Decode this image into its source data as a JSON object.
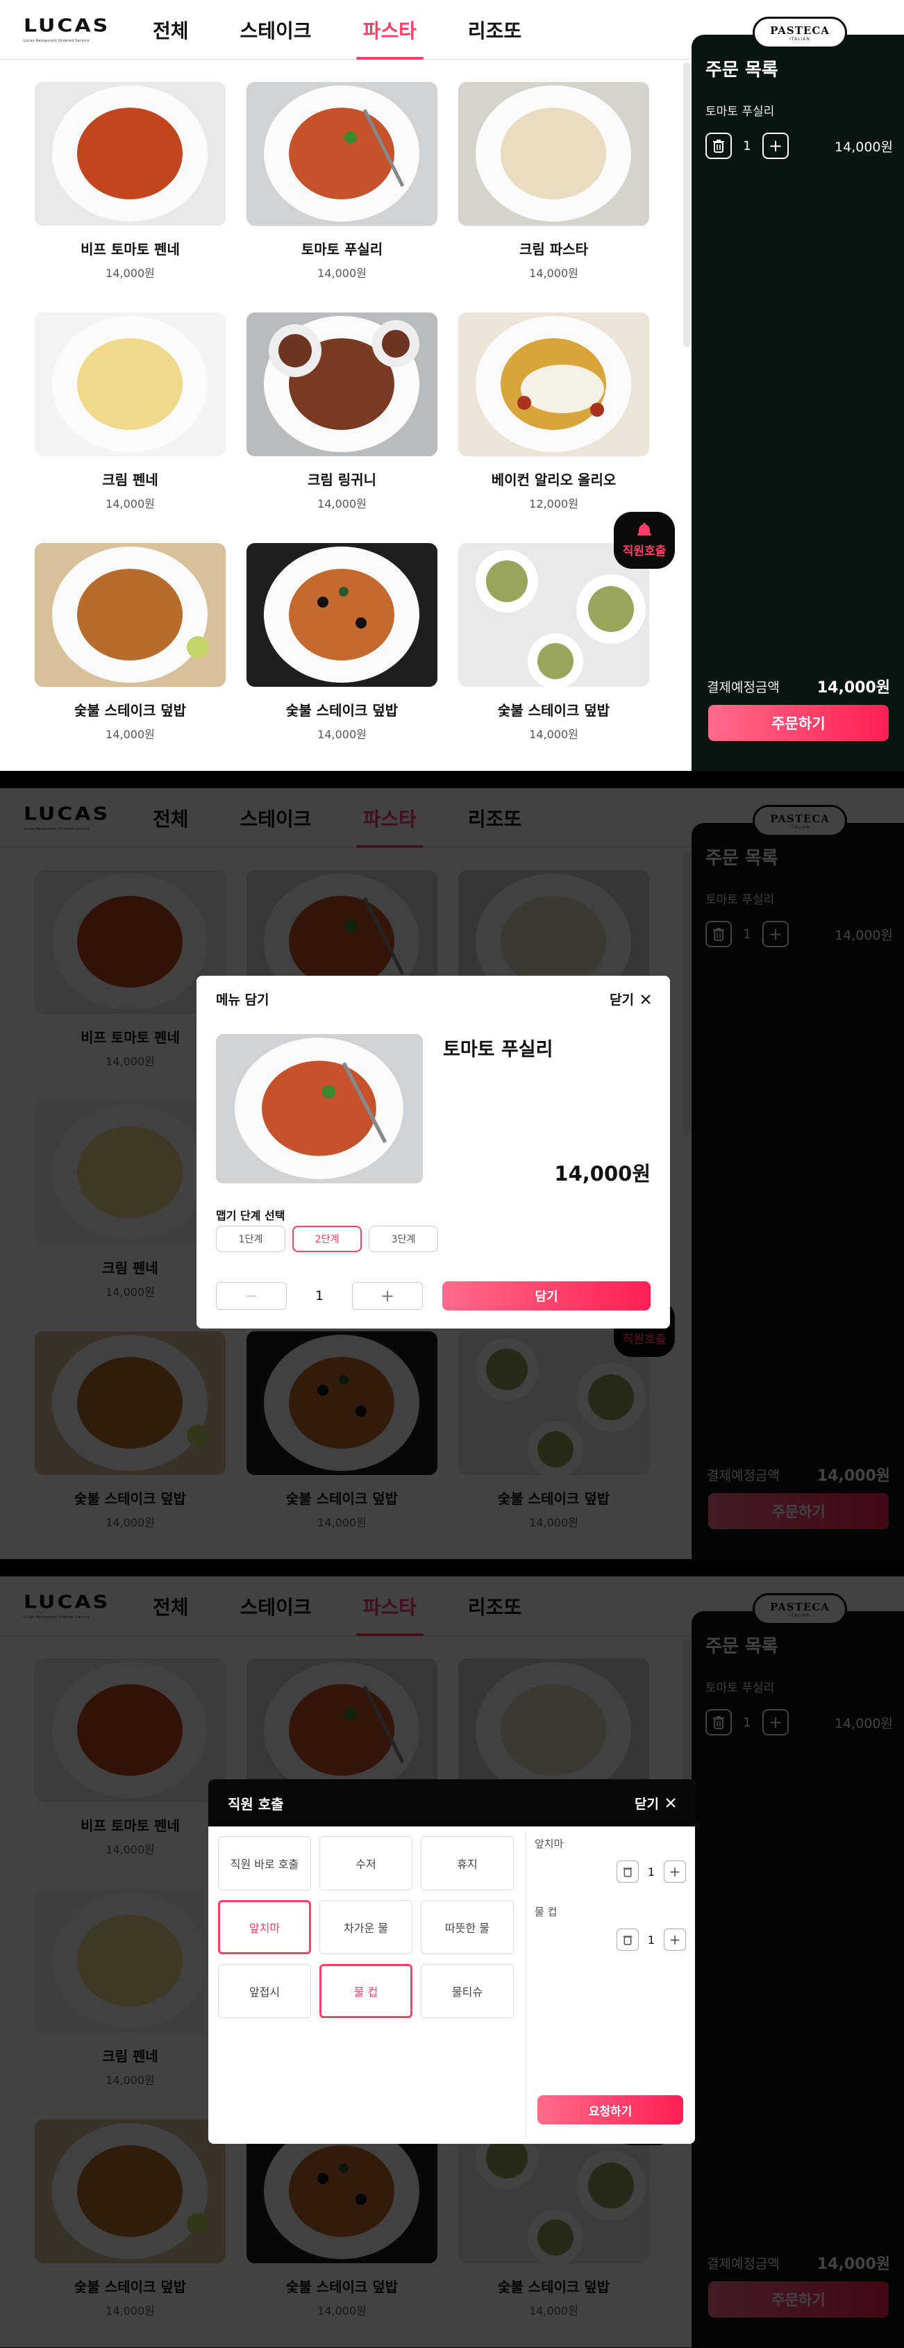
{
  "brand": {
    "logo": "LUCAS",
    "logo_sub": "Lucas Restaurant Ordered Service",
    "badge": "PASTECA",
    "badge_sub": "ITALIAN"
  },
  "nav": [
    "전체",
    "스테이크",
    "파스타",
    "리조또"
  ],
  "nav_active": "파스타",
  "menu": [
    {
      "name": "비프 토마토 펜네",
      "price": "14,000원"
    },
    {
      "name": "토마토 푸실리",
      "price": "14,000원"
    },
    {
      "name": "크림 파스타",
      "price": "14,000원"
    },
    {
      "name": "크림 펜네",
      "price": "14,000원"
    },
    {
      "name": "크림 링귀니",
      "price": "14,000원"
    },
    {
      "name": "베이컨 알리오 올리오",
      "price": "12,000원"
    },
    {
      "name": "숯불 스테이크 덮밥",
      "price": "14,000원"
    },
    {
      "name": "숯불 스테이크 덮밥",
      "price": "14,000원"
    },
    {
      "name": "숯불 스테이크 덮밥",
      "price": "14,000원"
    }
  ],
  "staff_button": "직원호출",
  "order": {
    "title": "주문 목록",
    "item_name": "토마토 푸실리",
    "item_qty": "1",
    "item_price": "14,000원",
    "pay_label": "결제예정금액",
    "pay_value": "14,000원",
    "order_button": "주문하기"
  },
  "add_modal": {
    "title": "메뉴 담기",
    "close": "닫기",
    "name": "토마토 푸실리",
    "price": "14,000원",
    "spice_label": "맵기 단계 선택",
    "levels": [
      "1단계",
      "2단계",
      "3단계"
    ],
    "active_level": "2단계",
    "minus": "−",
    "qty": "1",
    "plus": "+",
    "add_button": "담기"
  },
  "staff_modal": {
    "title": "직원 호출",
    "close": "닫기",
    "options": [
      "직원 바로 호출",
      "수저",
      "휴지",
      "앞치마",
      "차가운 물",
      "따뜻한 물",
      "앞접시",
      "물 컵",
      "물티슈"
    ],
    "selected": [
      "앞치마",
      "물 컵"
    ],
    "selected_list": [
      {
        "name": "앞치마",
        "qty": "1"
      },
      {
        "name": "물 컵",
        "qty": "1"
      }
    ],
    "request_button": "요청하기"
  },
  "colors": {
    "accent": "#ff3d68",
    "panel": "#081510",
    "overlay": "rgba(0,0,0,.74)"
  }
}
